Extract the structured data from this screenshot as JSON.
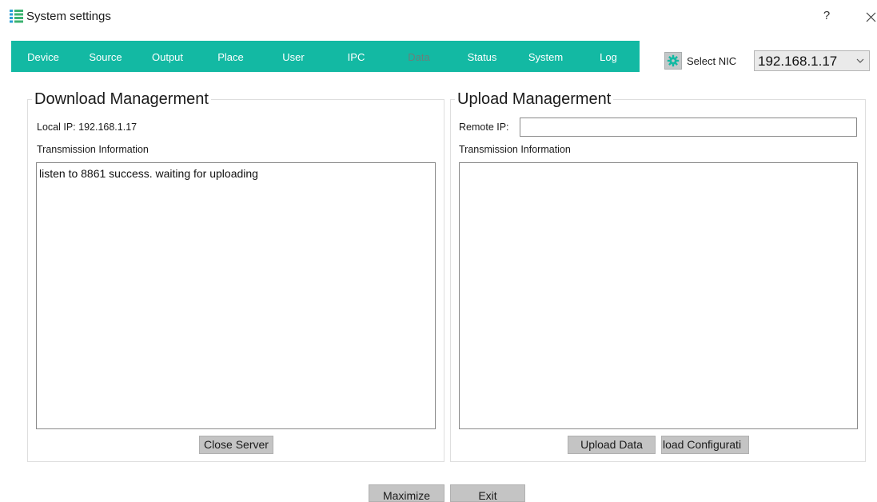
{
  "window": {
    "title": "System settings",
    "help_label": "?"
  },
  "tabs": [
    {
      "label": "Device"
    },
    {
      "label": "Source"
    },
    {
      "label": "Output"
    },
    {
      "label": "Place"
    },
    {
      "label": "User"
    },
    {
      "label": "IPC"
    },
    {
      "label": "Data",
      "active": true
    },
    {
      "label": "Status"
    },
    {
      "label": "System"
    },
    {
      "label": "Log"
    }
  ],
  "nic": {
    "label": "Select NIC",
    "selected": "192.168.1.17"
  },
  "download": {
    "title": "Download Managerment",
    "local_ip": "Local IP: 192.168.1.17",
    "trans_label": "Transmission Information",
    "trans_text": "listen to 8861 success. waiting for uploading",
    "close_server_label": "Close Server"
  },
  "upload": {
    "title": "Upload Managerment",
    "remote_ip_label": "Remote IP:",
    "remote_ip_value": "",
    "trans_label": "Transmission Information",
    "trans_text": "",
    "upload_data_label": "Upload Data",
    "upload_config_label": "load Configurati"
  },
  "footer": {
    "maximize_label": "Maximize",
    "exit_label": "Exit"
  },
  "colors": {
    "tab_bar": "#13b9a3",
    "tab_text": "#ffffff",
    "tab_active_text": "#6a7f7b",
    "button_bg": "#c4c4c4"
  },
  "icons": {
    "app": "list-grid-icon",
    "close": "close-icon",
    "gear": "gear-icon",
    "dropdown": "chevron-down-icon"
  }
}
